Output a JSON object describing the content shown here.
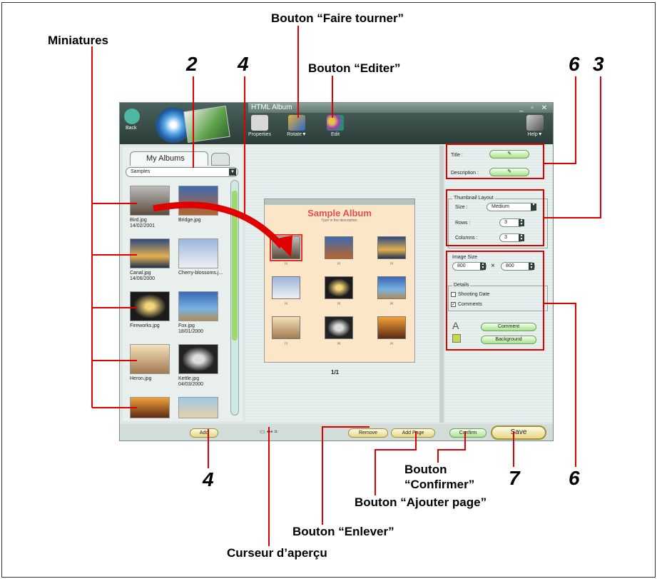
{
  "callouts": {
    "miniatures": "Miniatures",
    "faire_tourner": "Bouton “Faire tourner”",
    "editer": "Bouton “Editer”",
    "confirmer_1": "Bouton",
    "confirmer_2": "“Confirmer”",
    "ajouter_page": "Bouton “Ajouter page”",
    "enlever": "Bouton “Enlever”",
    "curseur": "Curseur d’aperçu"
  },
  "numbers": {
    "n2": "2",
    "n4_top": "4",
    "n6_top": "6",
    "n3": "3",
    "n4_bottom": "4",
    "n7": "7",
    "n6_bottom": "6"
  },
  "window": {
    "title": "HTML Album",
    "back_label": "Back",
    "toolbar": [
      {
        "label": "Properties"
      },
      {
        "label": "Rotate▼"
      },
      {
        "label": "Edit"
      }
    ],
    "help_label": "Help▼"
  },
  "left_panel": {
    "tab_label": "My Albums",
    "dropdown_value": "Samples",
    "thumbnails": [
      {
        "name": "Bird.jpg",
        "date": "14/02/2001"
      },
      {
        "name": "Bridge.jpg",
        "date": ""
      },
      {
        "name": "Canal.jpg",
        "date": "14/06/2000"
      },
      {
        "name": "Cherry-blossoms.j...",
        "date": ""
      },
      {
        "name": "Fireworks.jpg",
        "date": ""
      },
      {
        "name": "Fox.jpg",
        "date": "18/01/2000"
      },
      {
        "name": "Heron.jpg",
        "date": ""
      },
      {
        "name": "Kettle.jpg",
        "date": "04/03/2000"
      }
    ],
    "add_label": "Add"
  },
  "preview": {
    "album_title": "Sample Album",
    "subtitle": "Type in the description.",
    "photo_numbers": [
      "[1]",
      "[2]",
      "[3]",
      "[4]",
      "[5]",
      "[6]",
      "[7]",
      "[8]",
      "[9]"
    ],
    "page_indicator": "1/1",
    "remove_label": "Remove",
    "add_page_label": "Add Page"
  },
  "settings": {
    "title_label": "Title :",
    "description_label": "Description :",
    "thumbnail_layout_label": "Thumbnail Layout",
    "size_label": "Size :",
    "size_value": "Medium",
    "rows_label": "Rows :",
    "rows_value": "3",
    "columns_label": "Columns :",
    "columns_value": "3",
    "image_size_label": "Image Size",
    "width_value": "800",
    "times": "×",
    "height_value": "800",
    "details_label": "Details",
    "shooting_date_label": "Shooting Date",
    "comments_label": "Comments",
    "comment_btn": "Comment",
    "background_btn": "Background",
    "confirm_label": "Confirm",
    "save_label": "Save"
  }
}
